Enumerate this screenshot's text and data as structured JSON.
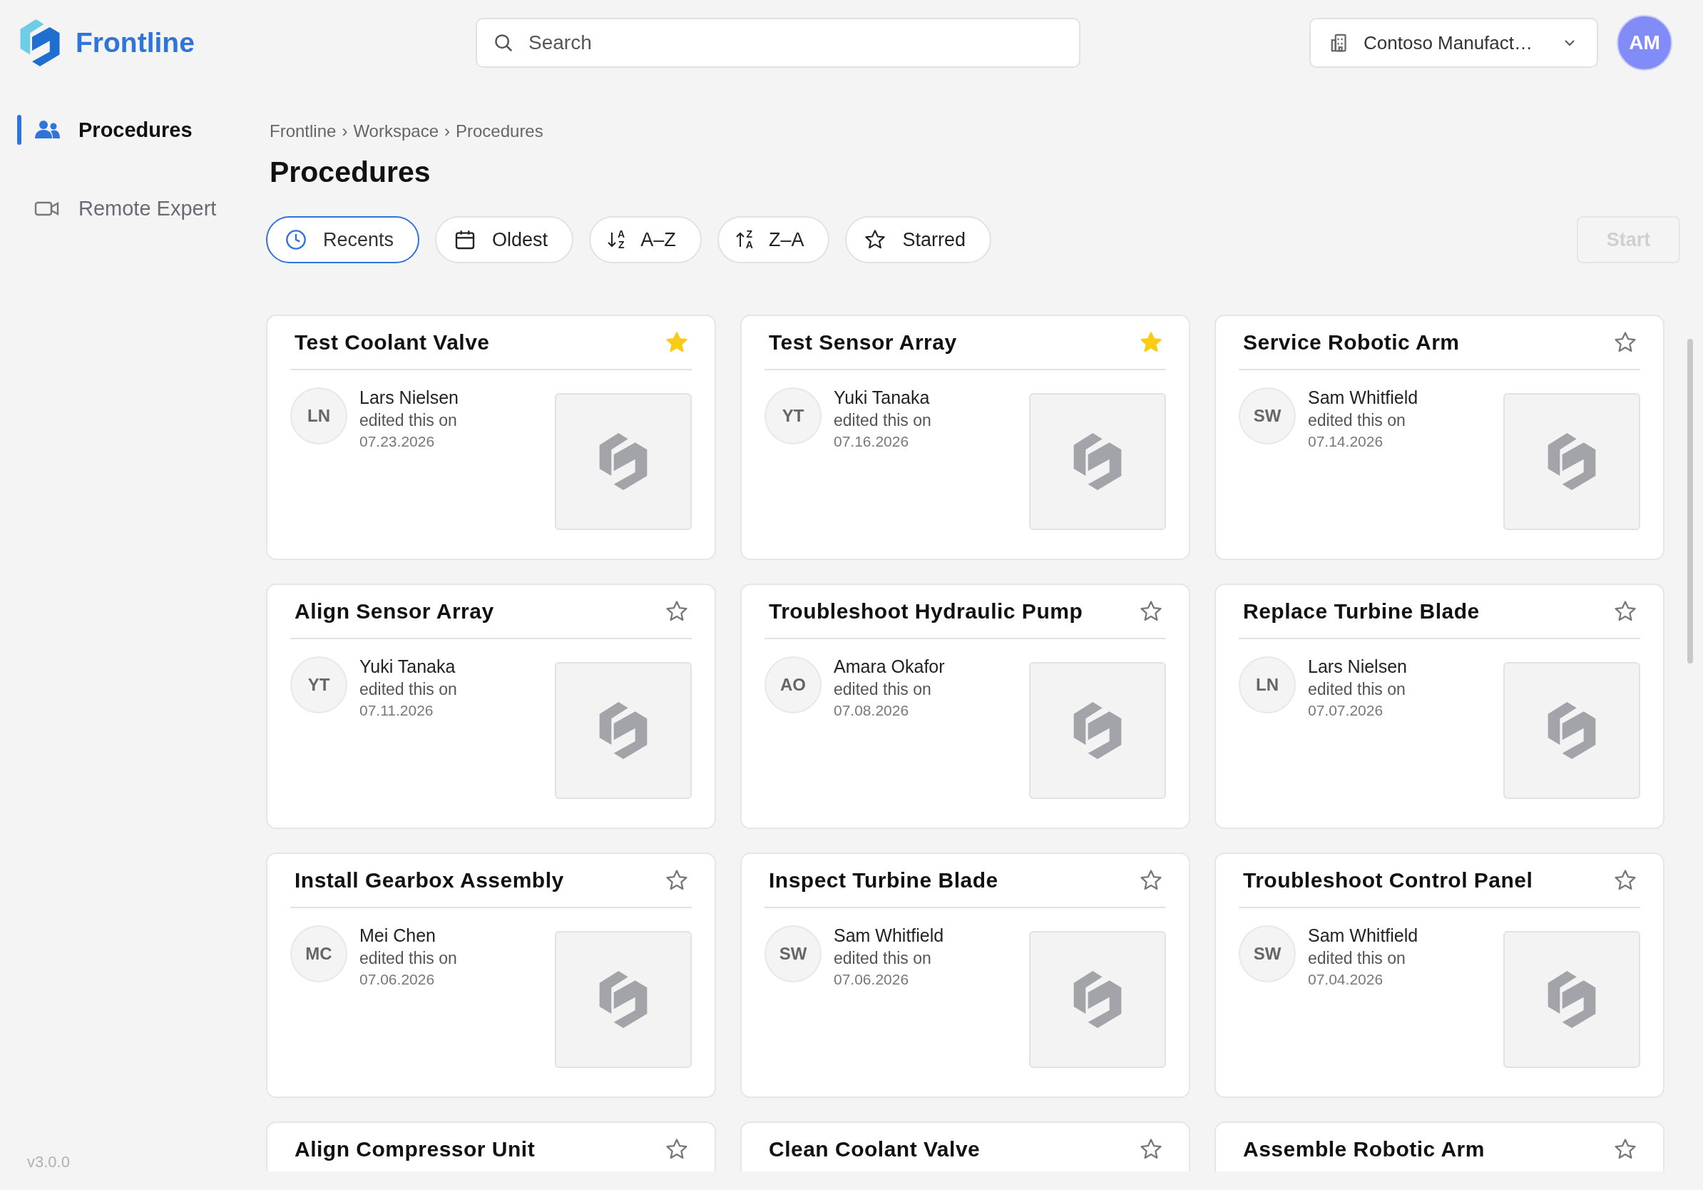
{
  "app": {
    "name": "Frontline"
  },
  "search": {
    "placeholder": "Search"
  },
  "organization": {
    "label": "Contoso Manufact…"
  },
  "user": {
    "initials": "AM"
  },
  "sidebar": {
    "items": [
      {
        "label": "Procedures",
        "kind": "people",
        "selected": true
      },
      {
        "label": "Remote Expert",
        "kind": "video",
        "selected": false
      }
    ],
    "version": "v3.0.0"
  },
  "breadcrumb": {
    "items": [
      "Frontline",
      "Workspace",
      "Procedures"
    ],
    "separator": "›"
  },
  "page_title": "Procedures",
  "sort_options": [
    {
      "label": "Recents",
      "kind": "time",
      "selected": true
    },
    {
      "label": "Oldest",
      "kind": "date",
      "selected": false
    },
    {
      "label": "A–Z",
      "kind": "ascending",
      "icon_text": [
        "A",
        "Z"
      ],
      "selected": false
    },
    {
      "label": "Z–A",
      "kind": "descending",
      "icon_text": [
        "Z",
        "A"
      ],
      "selected": false
    },
    {
      "label": "Starred",
      "kind": "starred",
      "selected": false
    }
  ],
  "start_button": {
    "label": "Start",
    "disabled": true
  },
  "procedures": [
    {
      "title": "Test Coolant Valve",
      "starred": true,
      "initials": "LN",
      "author": "Lars Nielsen",
      "action": "edited this on",
      "date": "07.23.2026"
    },
    {
      "title": "Test Sensor Array",
      "starred": true,
      "initials": "YT",
      "author": "Yuki Tanaka",
      "action": "edited this on",
      "date": "07.16.2026"
    },
    {
      "title": "Service Robotic Arm",
      "starred": false,
      "initials": "SW",
      "author": "Sam Whitfield",
      "action": "edited this on",
      "date": "07.14.2026"
    },
    {
      "title": "Align Sensor Array",
      "starred": false,
      "initials": "YT",
      "author": "Yuki Tanaka",
      "action": "edited this on",
      "date": "07.11.2026"
    },
    {
      "title": "Troubleshoot Hydraulic Pump",
      "starred": false,
      "initials": "AO",
      "author": "Amara Okafor",
      "action": "edited this on",
      "date": "07.08.2026"
    },
    {
      "title": "Replace Turbine Blade",
      "starred": false,
      "initials": "LN",
      "author": "Lars Nielsen",
      "action": "edited this on",
      "date": "07.07.2026"
    },
    {
      "title": "Install Gearbox Assembly",
      "starred": false,
      "initials": "MC",
      "author": "Mei Chen",
      "action": "edited this on",
      "date": "07.06.2026"
    },
    {
      "title": "Inspect Turbine Blade",
      "starred": false,
      "initials": "SW",
      "author": "Sam Whitfield",
      "action": "edited this on",
      "date": "07.06.2026"
    },
    {
      "title": "Troubleshoot Control Panel",
      "starred": false,
      "initials": "SW",
      "author": "Sam Whitfield",
      "action": "edited this on",
      "date": "07.04.2026"
    },
    {
      "title": "Align Compressor Unit",
      "starred": false
    },
    {
      "title": "Clean Coolant Valve",
      "starred": false
    },
    {
      "title": "Assemble Robotic Arm",
      "starred": false
    }
  ]
}
